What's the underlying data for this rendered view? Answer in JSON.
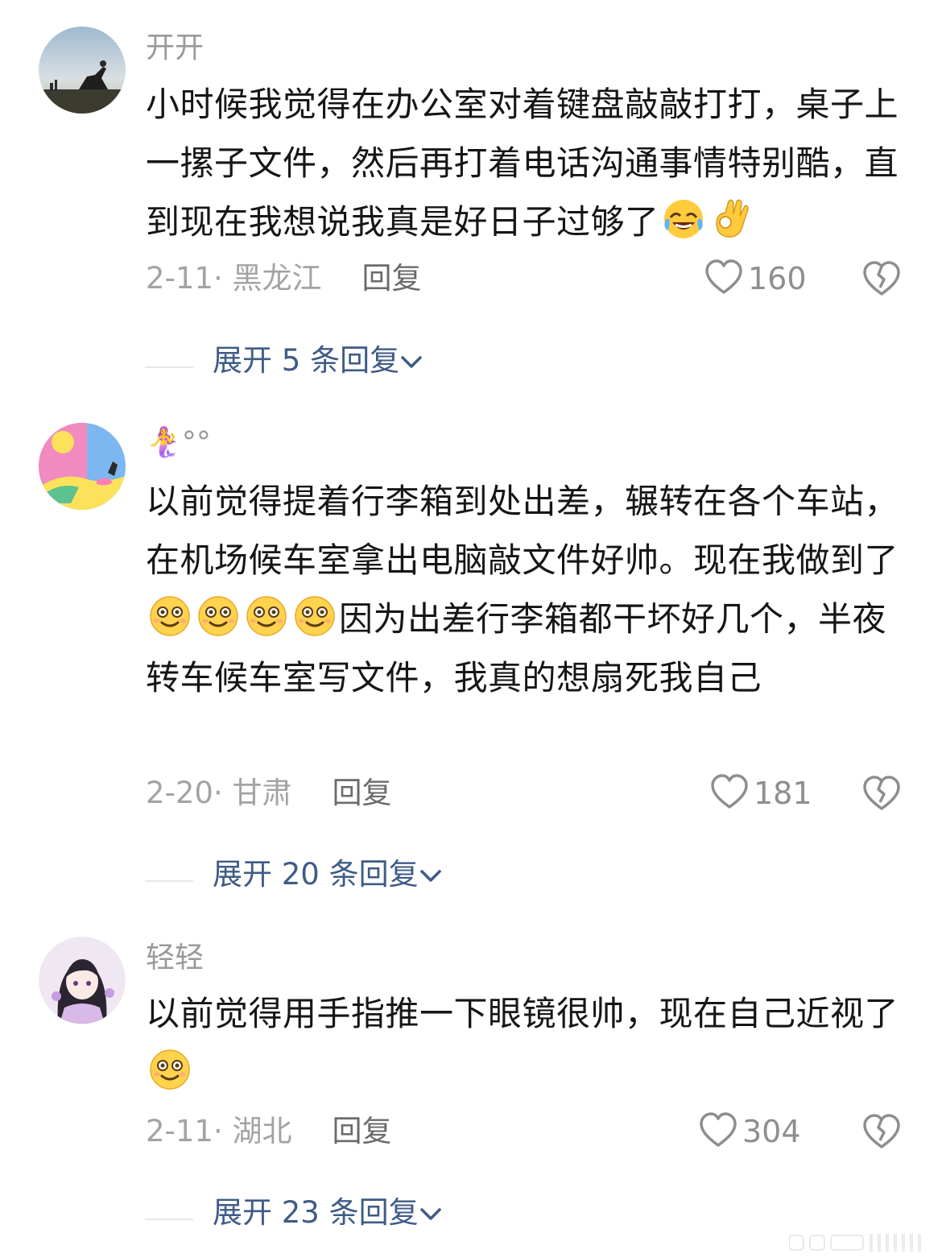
{
  "comments": [
    {
      "username": "开开",
      "text_parts": [
        "小时候我觉得在办公室对着键盘敲敲打打，桌子上一摞子文件，然后再打着电话沟通事情特别酷，直到现在我想说我真是好日子过够了"
      ],
      "emojis": [
        "laughing-crying-emoji",
        "ok-hand-emoji"
      ],
      "date_location": "2-11· 黑龙江",
      "reply_label": "回复",
      "likes": "160",
      "expand_label": "展开 5 条回复"
    },
    {
      "username": "🧜‍♀️°°",
      "text_parts": [
        "以前觉得提着行李箱到处出差，辗转在各个车站，在机场候车室拿出电脑敲文件好帅。现在我做到了",
        "因为出差行李箱都干坏好几个，半夜转车候车室写文件，我真的想扇死我自己"
      ],
      "emojis": [
        "dazed-smile-emoji",
        "dazed-smile-emoji",
        "dazed-smile-emoji",
        "dazed-smile-emoji"
      ],
      "date_location": "2-20· 甘肃",
      "reply_label": "回复",
      "likes": "181",
      "expand_label": "展开 20 条回复"
    },
    {
      "username": "轻轻",
      "text_parts": [
        "以前觉得用手指推一下眼镜很帅，现在自己近视了"
      ],
      "emojis": [
        "dazed-smile-emoji"
      ],
      "date_location": "2-11· 湖北",
      "reply_label": "回复",
      "likes": "304",
      "expand_label": "展开 23 条回复"
    }
  ],
  "colors": {
    "text": "#161616",
    "username": "#9a9a9a",
    "meta": "#a3a3a3",
    "reply": "#6b6b6b",
    "expand_link": "#3f5b86",
    "icon": "#8e8e8e"
  }
}
